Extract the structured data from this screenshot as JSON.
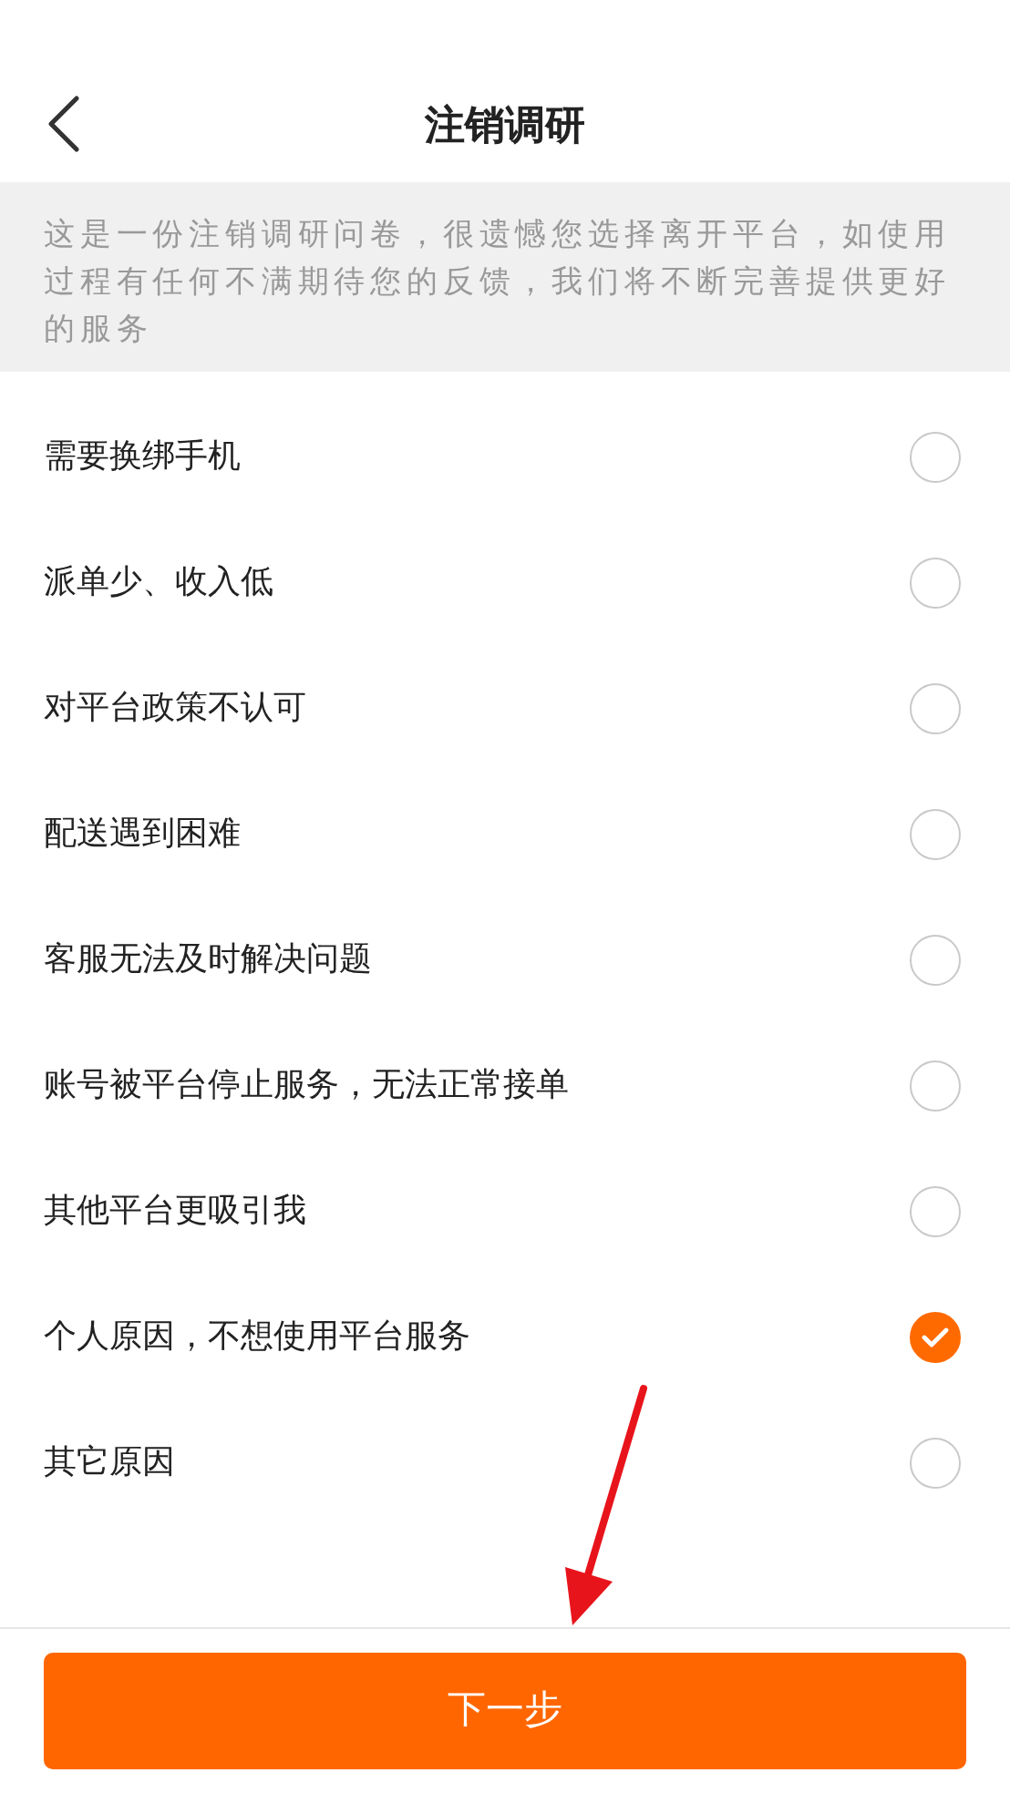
{
  "header": {
    "title": "注销调研"
  },
  "intro": "这是一份注销调研问卷，很遗憾您选择离开平台，如使用过程有任何不满期待您的反馈，我们将不断完善提供更好的服务",
  "options": [
    {
      "label": "需要换绑手机",
      "selected": false
    },
    {
      "label": "派单少、收入低",
      "selected": false
    },
    {
      "label": "对平台政策不认可",
      "selected": false
    },
    {
      "label": "配送遇到困难",
      "selected": false
    },
    {
      "label": "客服无法及时解决问题",
      "selected": false
    },
    {
      "label": "账号被平台停止服务，无法正常接单",
      "selected": false
    },
    {
      "label": "其他平台更吸引我",
      "selected": false
    },
    {
      "label": "个人原因，不想使用平台服务",
      "selected": true
    },
    {
      "label": "其它原因",
      "selected": false
    }
  ],
  "next_button": "下一步",
  "pointer_arrow": true
}
